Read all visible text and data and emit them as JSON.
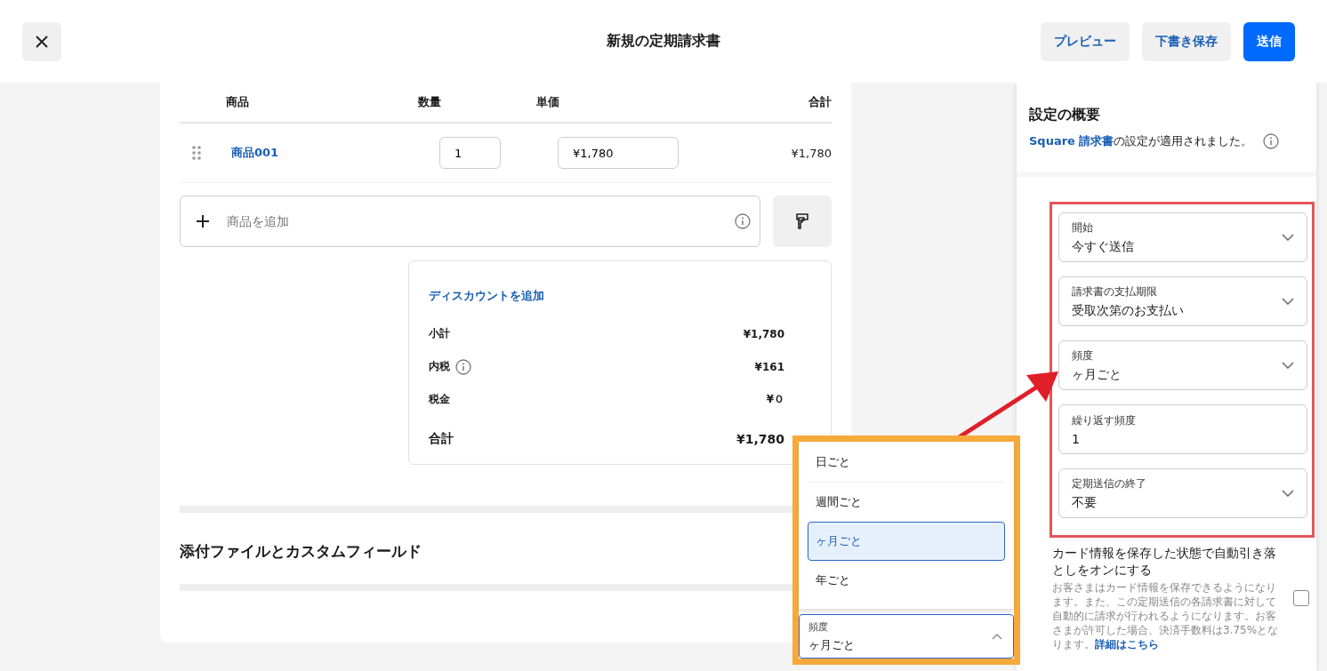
{
  "header": {
    "title": "新規の定期請求書",
    "buttons": [
      {
        "label": "プレビュー",
        "kind": "secondary"
      },
      {
        "label": "下書き保存",
        "kind": "secondary"
      },
      {
        "label": "送信",
        "kind": "primary"
      }
    ]
  },
  "items": {
    "columns": [
      "商品",
      "数量",
      "単価",
      "合計"
    ],
    "rows": [
      {
        "name": "商品001",
        "quantity": "1",
        "unit_price": "¥1,780",
        "total": "¥1,780"
      }
    ],
    "add_item": {
      "placeholder": "商品を追加"
    }
  },
  "summary": {
    "add_discount": "ディスカウントを追加",
    "lines": [
      {
        "label": "小計",
        "value": "¥1,780",
        "info": false,
        "kind": "normal"
      },
      {
        "label": "内税",
        "value": "¥161",
        "info": true,
        "kind": "normal"
      },
      {
        "label": "税金",
        "value": "¥０",
        "info": false,
        "kind": "normal"
      },
      {
        "label": "合計",
        "value": "¥1,780",
        "info": false,
        "kind": "total"
      }
    ]
  },
  "attachments": {
    "title": "添付ファイルとカスタムフィールド"
  },
  "settings": {
    "title": "設定の概要",
    "note": "**Square 請求書**の設定が適用されました。",
    "fields": [
      {
        "label": "開始",
        "value": "今すぐ送信",
        "kind": "select"
      },
      {
        "label": "請求書の支払期限",
        "value": "受取次第のお支払い",
        "kind": "select"
      },
      {
        "label": "頻度",
        "value": "ヶ月ごと",
        "kind": "select"
      },
      {
        "label": "繰り返す頻度",
        "value": "1",
        "kind": "text"
      },
      {
        "label": "定期送信の終了",
        "value": "不要",
        "kind": "select"
      }
    ],
    "auto_pay": {
      "title": "カード情報を保存した状態で自動引き落としをオンにする",
      "description": "お客さまはカード情報を保存できるようになります。また、この定期送信の各請求書に対して自動的に請求が行われるようになります。お客さまが許可した場合、決済手数料は3.75%となります。",
      "link": "詳細はこちら",
      "checked": false
    }
  },
  "dropdown": {
    "options": [
      {
        "label": "日ごと",
        "selected": false
      },
      {
        "label": "週間ごと",
        "selected": false
      },
      {
        "label": "ヶ月ごと",
        "selected": true
      },
      {
        "label": "年ごと",
        "selected": false
      }
    ],
    "field": {
      "label": "頻度",
      "value": "ヶ月ごと",
      "expanded": true
    }
  }
}
